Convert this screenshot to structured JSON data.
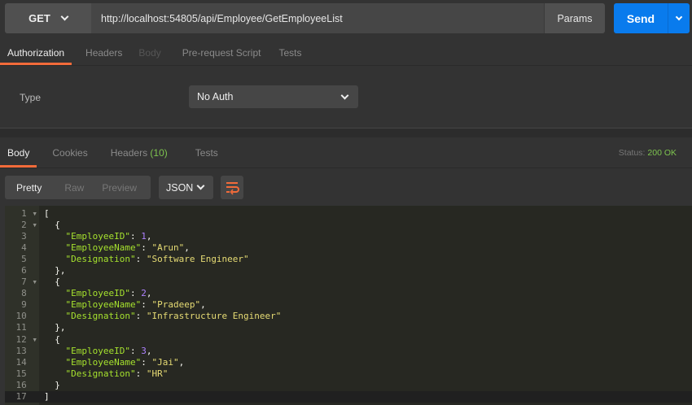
{
  "request": {
    "method": "GET",
    "url": "http://localhost:54805/api/Employee/GetEmployeeList",
    "params_label": "Params",
    "send_label": "Send"
  },
  "request_tabs": [
    "Authorization",
    "Headers",
    "Body",
    "Pre-request Script",
    "Tests"
  ],
  "auth": {
    "type_label": "Type",
    "type_value": "No Auth"
  },
  "response_tabs": {
    "body": "Body",
    "cookies": "Cookies",
    "headers": "Headers",
    "headers_count": "(10)",
    "tests": "Tests"
  },
  "status": {
    "label": "Status:",
    "value": "200 OK"
  },
  "view_modes": [
    "Pretty",
    "Raw",
    "Preview"
  ],
  "format": "JSON",
  "colors": {
    "accent": "#f26b3a",
    "send": "#097bed",
    "status_ok": "#7ec44f"
  },
  "code_lines": [
    [
      [
        "p",
        "["
      ]
    ],
    [
      [
        "p",
        "  {"
      ]
    ],
    [
      [
        "k",
        "    \"EmployeeID\""
      ],
      [
        "p",
        ": "
      ],
      [
        "n",
        "1"
      ],
      [
        "p",
        ","
      ]
    ],
    [
      [
        "k",
        "    \"EmployeeName\""
      ],
      [
        "p",
        ": "
      ],
      [
        "s",
        "\"Arun\""
      ],
      [
        "p",
        ","
      ]
    ],
    [
      [
        "k",
        "    \"Designation\""
      ],
      [
        "p",
        ": "
      ],
      [
        "s",
        "\"Software Engineer\""
      ]
    ],
    [
      [
        "p",
        "  },"
      ]
    ],
    [
      [
        "p",
        "  {"
      ]
    ],
    [
      [
        "k",
        "    \"EmployeeID\""
      ],
      [
        "p",
        ": "
      ],
      [
        "n",
        "2"
      ],
      [
        "p",
        ","
      ]
    ],
    [
      [
        "k",
        "    \"EmployeeName\""
      ],
      [
        "p",
        ": "
      ],
      [
        "s",
        "\"Pradeep\""
      ],
      [
        "p",
        ","
      ]
    ],
    [
      [
        "k",
        "    \"Designation\""
      ],
      [
        "p",
        ": "
      ],
      [
        "s",
        "\"Infrastructure Engineer\""
      ]
    ],
    [
      [
        "p",
        "  },"
      ]
    ],
    [
      [
        "p",
        "  {"
      ]
    ],
    [
      [
        "k",
        "    \"EmployeeID\""
      ],
      [
        "p",
        ": "
      ],
      [
        "n",
        "3"
      ],
      [
        "p",
        ","
      ]
    ],
    [
      [
        "k",
        "    \"EmployeeName\""
      ],
      [
        "p",
        ": "
      ],
      [
        "s",
        "\"Jai\""
      ],
      [
        "p",
        ","
      ]
    ],
    [
      [
        "k",
        "    \"Designation\""
      ],
      [
        "p",
        ": "
      ],
      [
        "s",
        "\"HR\""
      ]
    ],
    [
      [
        "p",
        "  }"
      ]
    ],
    [
      [
        "p",
        "]"
      ]
    ]
  ],
  "foldable_lines": [
    1,
    2,
    7,
    12
  ]
}
